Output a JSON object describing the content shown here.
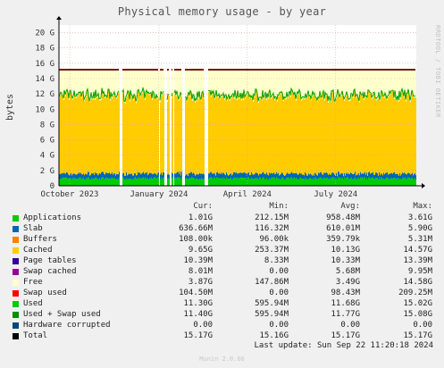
{
  "chart_data": {
    "type": "area",
    "title": "Physical memory usage - by year",
    "ylabel": "bytes",
    "ylim": [
      0,
      21
    ],
    "yunit": "G",
    "y_ticks": [
      {
        "value": 0,
        "label": "0"
      },
      {
        "value": 2,
        "label": "2 G"
      },
      {
        "value": 4,
        "label": "4 G"
      },
      {
        "value": 6,
        "label": "6 G"
      },
      {
        "value": 8,
        "label": "8 G"
      },
      {
        "value": 10,
        "label": "10 G"
      },
      {
        "value": 12,
        "label": "12 G"
      },
      {
        "value": 14,
        "label": "14 G"
      },
      {
        "value": 16,
        "label": "16 G"
      },
      {
        "value": 18,
        "label": "18 G"
      },
      {
        "value": 20,
        "label": "20 G"
      }
    ],
    "x_range": [
      "2023-09-20",
      "2024-09-22"
    ],
    "x_ticks": [
      {
        "date": "2023-10-01",
        "label": "October 2023"
      },
      {
        "date": "2024-01-01",
        "label": "January 2024"
      },
      {
        "date": "2024-04-01",
        "label": "April 2024"
      },
      {
        "date": "2024-07-01",
        "label": "July 2024"
      }
    ],
    "gaps": [
      [
        "2023-11-22",
        "2023-11-24"
      ],
      [
        "2024-01-01",
        "2024-01-02"
      ],
      [
        "2024-01-07",
        "2024-01-09"
      ],
      [
        "2024-01-12",
        "2024-01-14"
      ],
      [
        "2024-01-16",
        "2024-01-17"
      ],
      [
        "2024-01-25",
        "2024-01-28"
      ],
      [
        "2024-02-17",
        "2024-02-21"
      ]
    ],
    "grid": true,
    "series": [
      {
        "name": "Applications",
        "color": "#00cc00",
        "avg": 0.958,
        "min": 0.212,
        "max": 3.61
      },
      {
        "name": "Slab",
        "color": "#0066b3",
        "avg": 0.61,
        "min": 0.116,
        "max": 5.9
      },
      {
        "name": "Buffers",
        "color": "#ff8000",
        "avg": 0.00036,
        "min": 0.0001,
        "max": 0.0053
      },
      {
        "name": "Cached",
        "color": "#ffcc00",
        "avg": 10.13,
        "min": 0.253,
        "max": 14.57
      },
      {
        "name": "Page tables",
        "color": "#330099",
        "avg": 0.0103,
        "min": 0.0083,
        "max": 0.0134
      },
      {
        "name": "Swap cached",
        "color": "#990099",
        "avg": 5.7e-06,
        "min": 0,
        "max": 1e-05
      },
      {
        "name": "Free",
        "color": "#ffffcc",
        "avg": 3.49,
        "min": 0.148,
        "max": 14.58
      },
      {
        "name": "Used",
        "color": "#ff0000",
        "avg": 11.68,
        "min": 0.596,
        "max": 15.02
      },
      {
        "name": "Used + Swap used",
        "color": "#00a000",
        "avg": 11.77,
        "min": 0.596,
        "max": 15.08
      },
      {
        "name": "Total",
        "color": "#7b1010",
        "avg": 15.17,
        "min": 15.16,
        "max": 15.17
      }
    ]
  },
  "legend": {
    "headers": [
      "Cur:",
      "Min:",
      "Avg:",
      "Max:"
    ],
    "rows": [
      {
        "name": "Applications",
        "color": "#00cc00",
        "cur": "1.01G",
        "min": "212.15M",
        "avg": "958.48M",
        "max": "3.61G"
      },
      {
        "name": "Slab",
        "color": "#0066b3",
        "cur": "636.66M",
        "min": "116.32M",
        "avg": "610.01M",
        "max": "5.90G"
      },
      {
        "name": "Buffers",
        "color": "#ff8000",
        "cur": "108.00k",
        "min": "96.00k",
        "avg": "359.79k",
        "max": "5.31M"
      },
      {
        "name": "Cached",
        "color": "#ffcc00",
        "cur": "9.65G",
        "min": "253.37M",
        "avg": "10.13G",
        "max": "14.57G"
      },
      {
        "name": "Page tables",
        "color": "#330099",
        "cur": "10.39M",
        "min": "8.33M",
        "avg": "10.33M",
        "max": "13.39M"
      },
      {
        "name": "Swap cached",
        "color": "#990099",
        "cur": "8.01M",
        "min": "0.00",
        "avg": "5.68M",
        "max": "9.95M"
      },
      {
        "name": "Free",
        "color": "#ffffcc",
        "cur": "3.87G",
        "min": "147.86M",
        "avg": "3.49G",
        "max": "14.58G"
      },
      {
        "name": "Swap used",
        "color": "#ff0000",
        "cur": "104.50M",
        "min": "0.00",
        "avg": "98.43M",
        "max": "209.25M"
      },
      {
        "name": "Used",
        "color": "#00cc00",
        "cur": "11.30G",
        "min": "595.94M",
        "avg": "11.68G",
        "max": "15.02G"
      },
      {
        "name": "Used + Swap used",
        "color": "#008f00",
        "cur": "11.40G",
        "min": "595.94M",
        "avg": "11.77G",
        "max": "15.08G"
      },
      {
        "name": "Hardware corrupted",
        "color": "#00487d",
        "cur": "0.00",
        "min": "0.00",
        "avg": "0.00",
        "max": "0.00"
      },
      {
        "name": "Total",
        "color": "#000000",
        "cur": "15.17G",
        "min": "15.16G",
        "avg": "15.17G",
        "max": "15.17G"
      }
    ]
  },
  "footer": {
    "last_update": "Last update: Sun Sep 22 11:20:18 2024",
    "munin": "Munin 2.0.66"
  },
  "side_label": "RRDTOOL / TOBI OETIKER"
}
